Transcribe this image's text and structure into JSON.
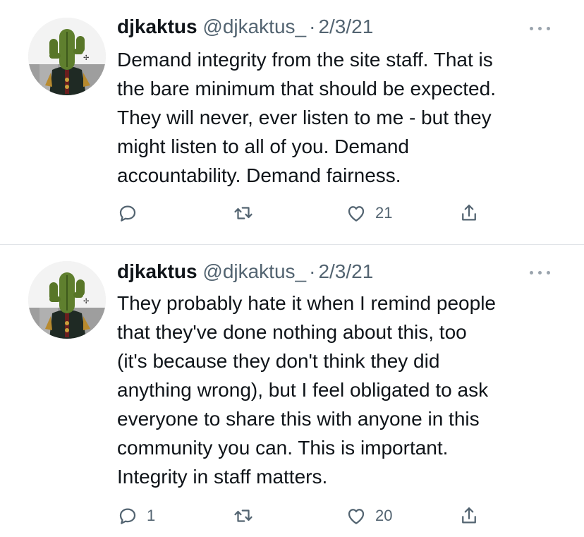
{
  "tweets": [
    {
      "name": "djkaktus",
      "handle": "@djkaktus_",
      "separator": "·",
      "date": "2/3/21",
      "lines": [
        "Demand integrity from the site staff. That is",
        "the bare minimum that should be expected.",
        "They will never, ever listen to me - but they",
        "might listen to all of you. Demand",
        "accountability. Demand fairness."
      ],
      "replies": "",
      "retweets": "",
      "likes": "21"
    },
    {
      "name": "djkaktus",
      "handle": "@djkaktus_",
      "separator": "·",
      "date": "2/3/21",
      "lines": [
        "They probably hate it when I remind people",
        "that they've done nothing about this, too",
        "(it's because they don't think they did",
        "anything wrong), but I feel obligated to ask",
        "everyone to share this with anyone in this",
        "community you can. This is important.",
        "Integrity in staff matters."
      ],
      "replies": "1",
      "retweets": "",
      "likes": "20"
    }
  ],
  "icons": {
    "reply": "reply-icon",
    "retweet": "retweet-icon",
    "like": "heart-icon",
    "share": "share-icon",
    "more": "more-icon",
    "avatar": "cactus-avatar"
  },
  "colors": {
    "text": "#0f1419",
    "secondary": "#536471",
    "divider": "#e1e4e8",
    "avatar_bg": "#ececec"
  }
}
